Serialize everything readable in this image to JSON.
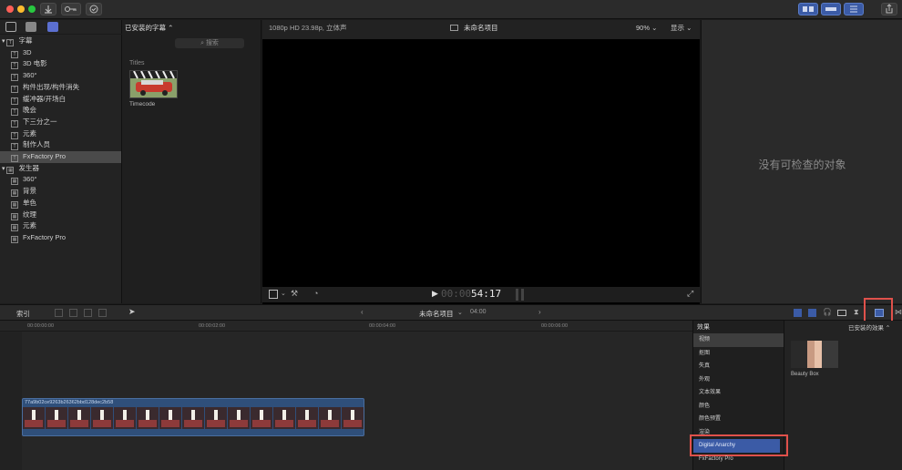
{
  "sidebar": {
    "items": [
      {
        "label": "字幕",
        "level": 0,
        "icon": "titles-icon",
        "expanded": true
      },
      {
        "label": "3D",
        "level": 1,
        "icon": "title-category-icon"
      },
      {
        "label": "3D 电影",
        "level": 1,
        "icon": "title-category-icon"
      },
      {
        "label": "360°",
        "level": 1,
        "icon": "title-category-icon"
      },
      {
        "label": "构件出现/构件消失",
        "level": 1,
        "icon": "title-category-icon"
      },
      {
        "label": "缓冲器/开场白",
        "level": 1,
        "icon": "title-category-icon"
      },
      {
        "label": "晚会",
        "level": 1,
        "icon": "title-category-icon"
      },
      {
        "label": "下三分之一",
        "level": 1,
        "icon": "title-category-icon"
      },
      {
        "label": "元素",
        "level": 1,
        "icon": "title-category-icon"
      },
      {
        "label": "制作人员",
        "level": 1,
        "icon": "title-category-icon"
      },
      {
        "label": "FxFactory Pro",
        "level": 1,
        "icon": "title-category-icon",
        "selected": true
      },
      {
        "label": "发生器",
        "level": 0,
        "icon": "generators-icon",
        "expanded": true
      },
      {
        "label": "360°",
        "level": 1,
        "icon": "generator-category-icon"
      },
      {
        "label": "背景",
        "level": 1,
        "icon": "generator-category-icon"
      },
      {
        "label": "单色",
        "level": 1,
        "icon": "generator-category-icon"
      },
      {
        "label": "纹理",
        "level": 1,
        "icon": "generator-category-icon"
      },
      {
        "label": "元素",
        "level": 1,
        "icon": "generator-category-icon"
      },
      {
        "label": "FxFactory Pro",
        "level": 1,
        "icon": "generator-category-icon"
      }
    ]
  },
  "browser": {
    "header": "已安装的字幕 ⌃",
    "search_placeholder": "搜索",
    "section": "Titles",
    "thumb_label": "Timecode"
  },
  "viewer": {
    "format": "1080p HD 23.98p, 立体声",
    "project": "未命名项目",
    "zoom": "90% ⌄",
    "view": "显示 ⌄",
    "timecode_dim": "00:00",
    "timecode": "54:17"
  },
  "inspector": {
    "empty": "没有可检查的对象"
  },
  "timeline": {
    "index_label": "索引",
    "project": "未命名项目",
    "duration": "04:00",
    "ruler": [
      "00:00:00:00",
      "00:00:02:00",
      "00:00:04:00",
      "00:00:06:00"
    ],
    "clip_name": "77a9b02ce9263b26362bbd128dec2b58"
  },
  "effects": {
    "header": "效果",
    "installed": "已安装的效果 ⌃",
    "categories": [
      "视频",
      "抠图",
      "失真",
      "外观",
      "文本效果",
      "颜色",
      "颜色预置",
      "渲染",
      "Digital Anarchy",
      "FxFactory Pro"
    ],
    "selected_index": 0,
    "highlighted_index": 8,
    "thumb_label": "Beauty Box"
  },
  "colors": {
    "accent_blue": "#3b5ba6",
    "highlight_red": "#e0514b",
    "selection_gray": "#4a4a4a"
  }
}
